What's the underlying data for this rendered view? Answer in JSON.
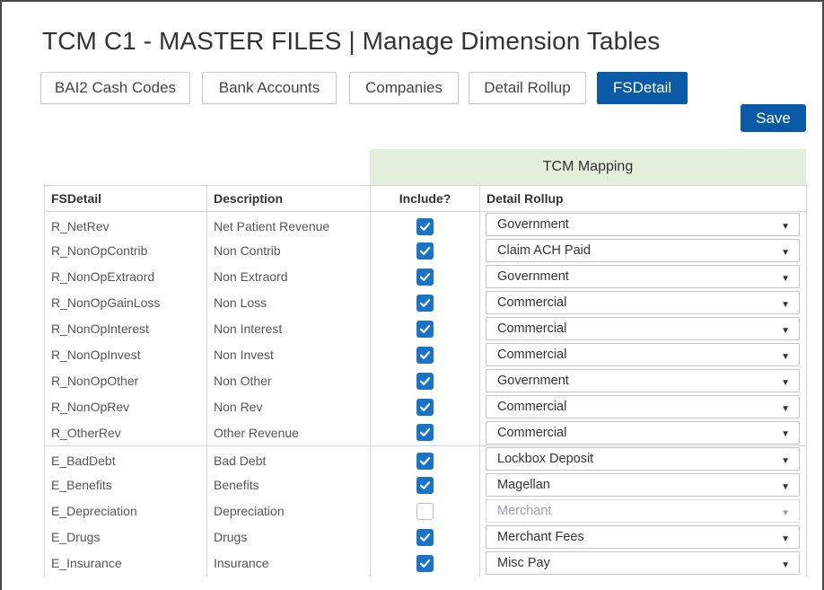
{
  "page": {
    "title": "TCM C1 - MASTER FILES | Manage Dimension Tables"
  },
  "tabs": [
    {
      "label": "BAI2 Cash Codes"
    },
    {
      "label": "Bank Accounts"
    },
    {
      "label": "Companies"
    },
    {
      "label": "Detail Rollup"
    },
    {
      "label": "FSDetail"
    }
  ],
  "save_label": "Save",
  "grid": {
    "group_header": "TCM Mapping",
    "columns": [
      "FSDetail",
      "Description",
      "Include?",
      "Detail Rollup"
    ],
    "rows": [
      {
        "fsdetail": "R_NetRev",
        "description": "Net Patient Revenue",
        "include": true,
        "rollup": "Government"
      },
      {
        "fsdetail": "R_NonOpContrib",
        "description": "Non Contrib",
        "include": true,
        "rollup": "Claim ACH Paid"
      },
      {
        "fsdetail": "R_NonOpExtraord",
        "description": "Non Extraord",
        "include": true,
        "rollup": "Government"
      },
      {
        "fsdetail": "R_NonOpGainLoss",
        "description": "Non Loss",
        "include": true,
        "rollup": "Commercial"
      },
      {
        "fsdetail": "R_NonOpInterest",
        "description": "Non Interest",
        "include": true,
        "rollup": "Commercial"
      },
      {
        "fsdetail": "R_NonOpInvest",
        "description": "Non Invest",
        "include": true,
        "rollup": "Commercial"
      },
      {
        "fsdetail": "R_NonOpOther",
        "description": "Non Other",
        "include": true,
        "rollup": "Government"
      },
      {
        "fsdetail": "R_NonOpRev",
        "description": "Non Rev",
        "include": true,
        "rollup": "Commercial"
      },
      {
        "fsdetail": "R_OtherRev",
        "description": "Other Revenue",
        "include": true,
        "rollup": "Commercial"
      },
      {
        "fsdetail": "E_BadDebt",
        "description": "Bad Debt",
        "include": true,
        "rollup": "Lockbox Deposit"
      },
      {
        "fsdetail": "E_Benefits",
        "description": "Benefits",
        "include": true,
        "rollup": "Magellan"
      },
      {
        "fsdetail": "E_Depreciation",
        "description": "Depreciation",
        "include": false,
        "rollup": "Merchant"
      },
      {
        "fsdetail": "E_Drugs",
        "description": "Drugs",
        "include": true,
        "rollup": "Merchant Fees"
      },
      {
        "fsdetail": "E_Insurance",
        "description": "Insurance",
        "include": true,
        "rollup": "Misc Pay"
      }
    ]
  },
  "icons": {
    "check": "checkmark-icon",
    "dropdown": "triangle-down-icon"
  },
  "colors": {
    "primary": "#0a5aa7",
    "checkbox": "#1a73c7",
    "group_header_bg": "#e3efdb"
  }
}
